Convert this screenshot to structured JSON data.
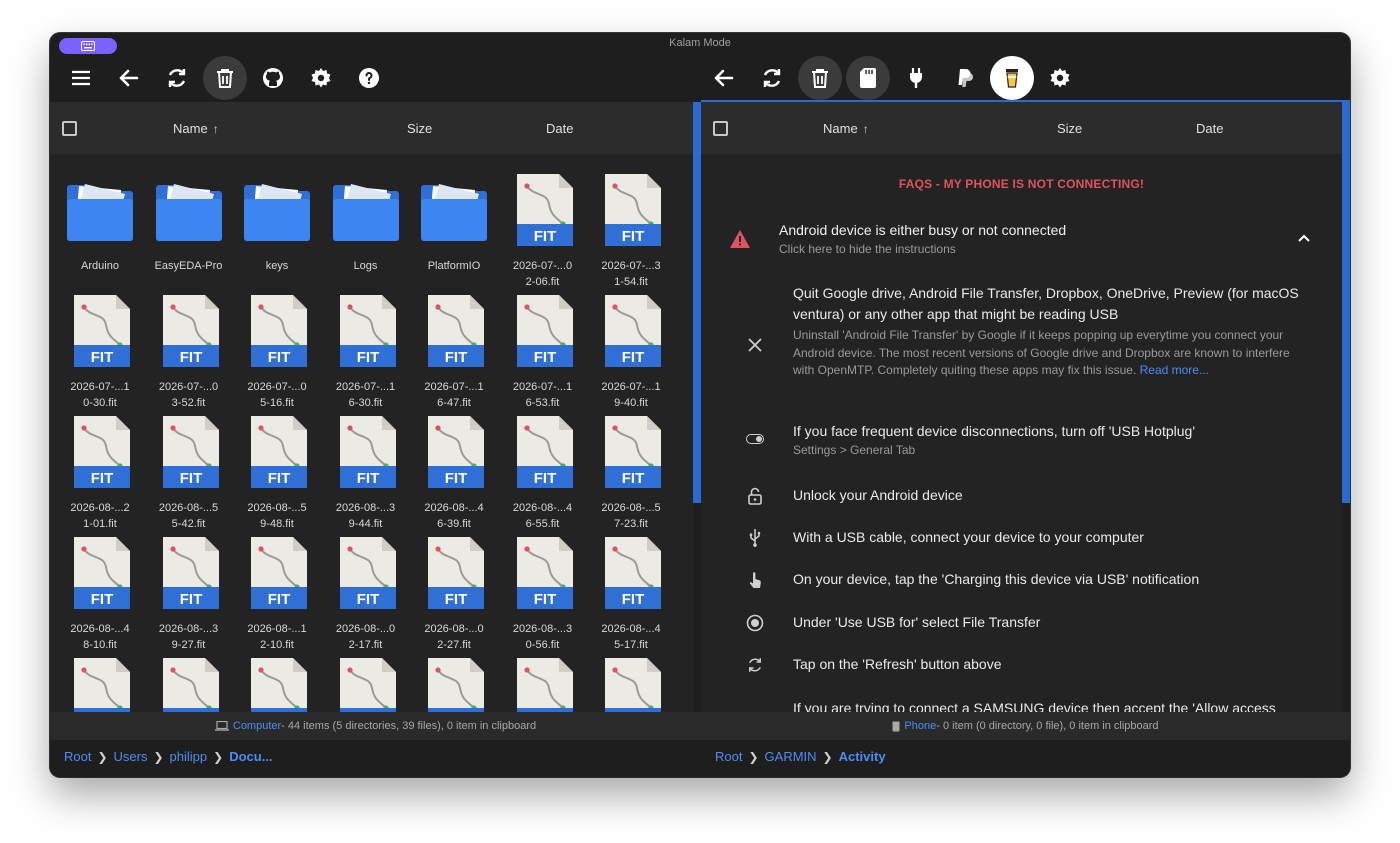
{
  "window": {
    "title": "Kalam Mode"
  },
  "left": {
    "columns": {
      "name": "Name",
      "size": "Size",
      "date": "Date"
    },
    "folders": [
      "Arduino",
      "EasyEDA-Pro",
      "keys",
      "Logs",
      "PlatformIO"
    ],
    "files": [
      [
        "2026-07-...0",
        "2-06.fit"
      ],
      [
        "2026-07-...3",
        "1-54.fit"
      ],
      [
        "2026-07-...1",
        "0-30.fit"
      ],
      [
        "2026-07-...0",
        "3-52.fit"
      ],
      [
        "2026-07-...0",
        "5-16.fit"
      ],
      [
        "2026-07-...1",
        "6-30.fit"
      ],
      [
        "2026-07-...1",
        "6-47.fit"
      ],
      [
        "2026-07-...1",
        "6-53.fit"
      ],
      [
        "2026-07-...1",
        "9-40.fit"
      ],
      [
        "2026-08-...2",
        "1-01.fit"
      ],
      [
        "2026-08-...5",
        "5-42.fit"
      ],
      [
        "2026-08-...5",
        "9-48.fit"
      ],
      [
        "2026-08-...3",
        "9-44.fit"
      ],
      [
        "2026-08-...4",
        "6-39.fit"
      ],
      [
        "2026-08-...4",
        "6-55.fit"
      ],
      [
        "2026-08-...5",
        "7-23.fit"
      ],
      [
        "2026-08-...4",
        "8-10.fit"
      ],
      [
        "2026-08-...3",
        "9-27.fit"
      ],
      [
        "2026-08-...1",
        "2-10.fit"
      ],
      [
        "2026-08-...0",
        "2-17.fit"
      ],
      [
        "2026-08-...0",
        "2-27.fit"
      ],
      [
        "2026-08-...3",
        "0-56.fit"
      ],
      [
        "2026-08-...4",
        "5-17.fit"
      ],
      [
        "",
        ""
      ],
      [
        "",
        ""
      ],
      [
        "",
        ""
      ],
      [
        "",
        ""
      ],
      [
        "",
        ""
      ],
      [
        "",
        ""
      ],
      [
        "",
        ""
      ]
    ],
    "file_badge": "FIT",
    "status": {
      "device": "Computer",
      "text": " - 44 items (5 directories, 39 files), 0 item in clipboard"
    },
    "breadcrumb": [
      "Root",
      "Users",
      "philipp",
      "Docu..."
    ]
  },
  "right": {
    "columns": {
      "name": "Name",
      "size": "Size",
      "date": "Date"
    },
    "faq_title": "FAQS - MY PHONE IS NOT CONNECTING!",
    "warning": {
      "title": "Android device is either busy or not connected",
      "subtitle": "Click here to hide the instructions"
    },
    "items": [
      {
        "icon": "close-icon",
        "title": "Quit Google drive, Android File Transfer, Dropbox, OneDrive, Preview (for macOS ventura) or any other app that might be reading USB",
        "sub": "Uninstall 'Android File Transfer' by Google if it keeps popping up everytime you connect your Android device. The most recent versions of Google drive and Dropbox are known to interfere with OpenMTP. Completely quiting these apps may fix this issue. ",
        "link": "Read more..."
      },
      {
        "icon": "toggle-icon",
        "title": "If you face frequent device disconnections, turn off 'USB Hotplug'",
        "sub": "Settings > General Tab"
      },
      {
        "icon": "unlock-icon",
        "title": "Unlock your Android device"
      },
      {
        "icon": "usb-icon",
        "title": "With a USB cable, connect your device to your computer"
      },
      {
        "icon": "tap-icon",
        "title": "On your device, tap the 'Charging this device via USB' notification"
      },
      {
        "icon": "radio-icon",
        "title": "Under 'Use USB for' select File Transfer"
      },
      {
        "icon": "refresh-icon",
        "title": "Tap on the 'Refresh' button above"
      },
      {
        "icon": "samsung-icon",
        "title": "If you are trying to connect a SAMSUNG device then accept the 'Allow access"
      }
    ],
    "status": {
      "device": "Phone",
      "text": " - 0 item (0 directory, 0 file), 0 item in clipboard"
    },
    "breadcrumb": [
      "Root",
      "GARMIN",
      "Activity"
    ]
  }
}
